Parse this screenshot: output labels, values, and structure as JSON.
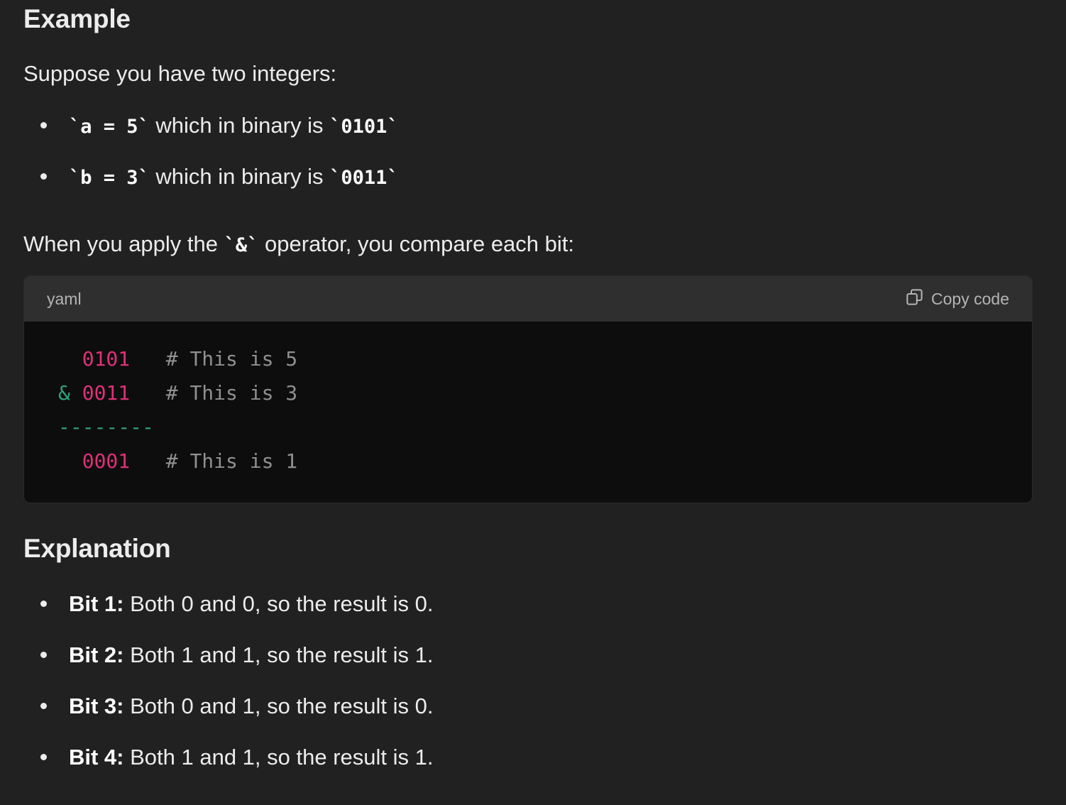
{
  "example": {
    "heading": "Example",
    "intro": "Suppose you have two integers:",
    "items": [
      {
        "code": "`a = 5`",
        "mid": " which in binary is ",
        "code2": "`0101`"
      },
      {
        "code": "`b = 3`",
        "mid": " which in binary is ",
        "code2": "`0011`"
      }
    ],
    "apply_pre": "When you apply the ",
    "apply_code": "`&`",
    "apply_post": " operator, you compare each bit:"
  },
  "codeblock": {
    "language": "yaml",
    "copy_label": "Copy code",
    "lines": [
      {
        "prefix": "  ",
        "num": "0101",
        "comment": "   # This is 5"
      },
      {
        "prefix": "& ",
        "num": "0011",
        "comment": "   # This is 3"
      },
      {
        "dashes": "--------"
      },
      {
        "prefix": "  ",
        "num": "0001",
        "comment": "   # This is 1"
      }
    ]
  },
  "explanation": {
    "heading": "Explanation",
    "items": [
      {
        "label": "Bit 1:",
        "text": " Both 0 and 0, so the result is 0."
      },
      {
        "label": "Bit 2:",
        "text": " Both 1 and 1, so the result is 1."
      },
      {
        "label": "Bit 3:",
        "text": " Both 0 and 1, so the result is 0."
      },
      {
        "label": "Bit 4:",
        "text": " Both 1 and 1, so the result is 1."
      }
    ]
  }
}
